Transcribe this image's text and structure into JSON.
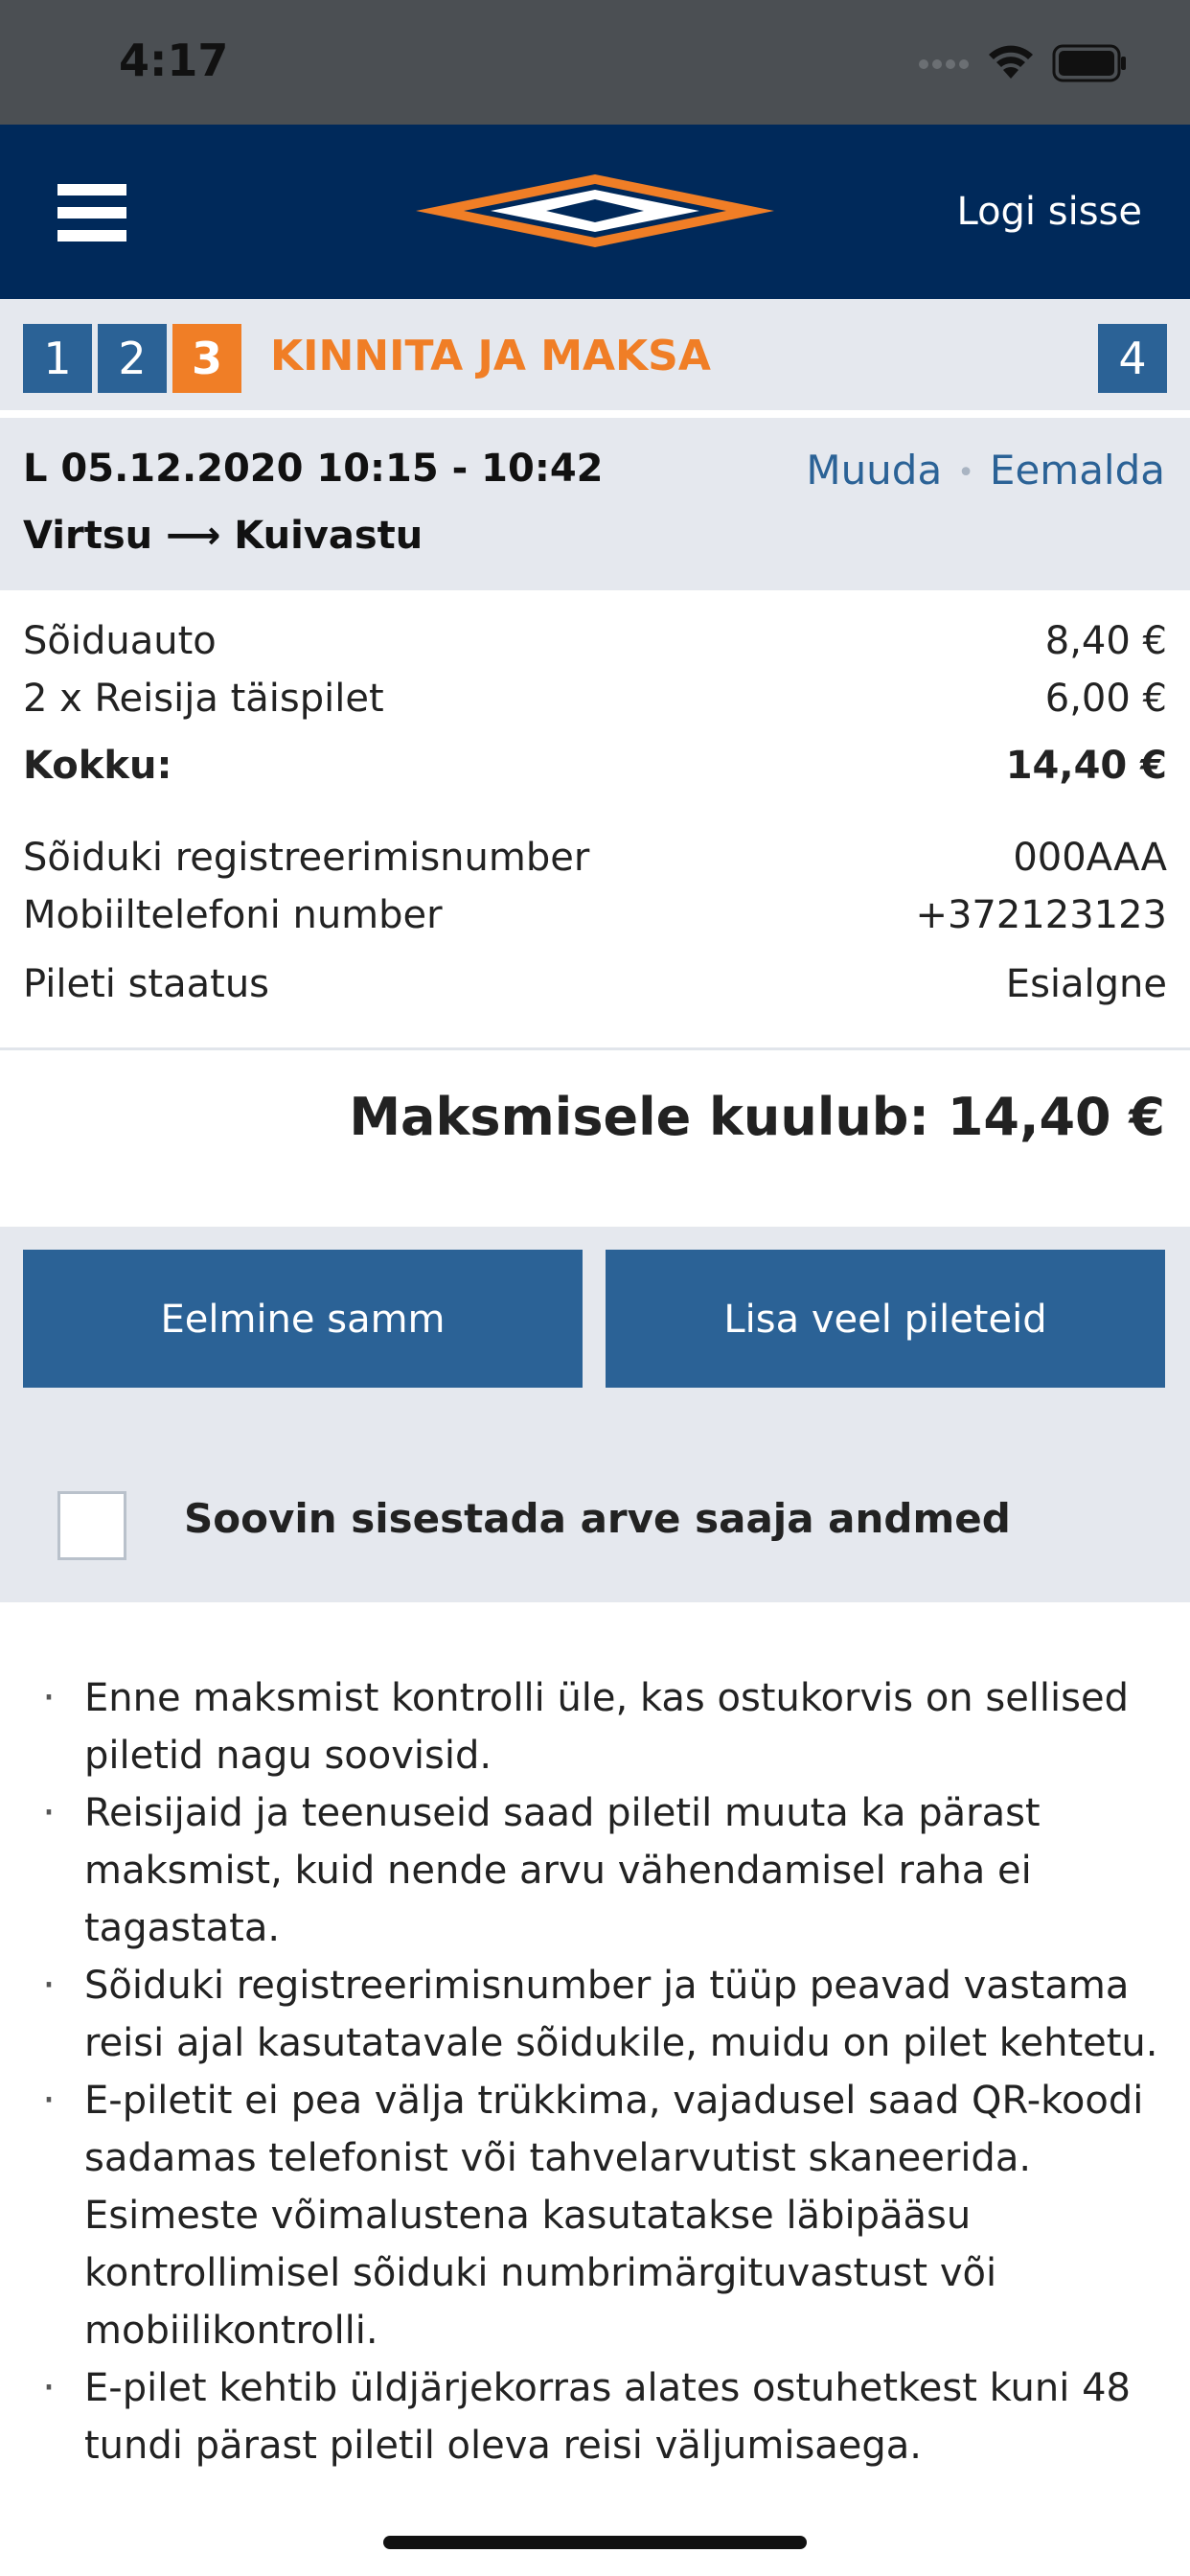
{
  "status_bar": {
    "time": "4:17"
  },
  "header": {
    "login_label": "Logi sisse",
    "colors": {
      "bg": "#00295a",
      "logo_orange": "#f07e26",
      "logo_white": "#ffffff"
    }
  },
  "steps": {
    "items": [
      {
        "label": "1",
        "active": false
      },
      {
        "label": "2",
        "active": false
      },
      {
        "label": "3",
        "active": true
      },
      {
        "label": "4",
        "active": false
      }
    ],
    "current_title": "KINNITA JA MAKSA",
    "colors": {
      "step": "#2b6296",
      "active": "#f07e26"
    }
  },
  "trip": {
    "datetime": "L 05.12.2020 10:15 - 10:42",
    "route": "Virtsu ⟶ Kuivastu",
    "edit_label": "Muuda",
    "remove_label": "Eemalda"
  },
  "details": {
    "items": [
      {
        "label": "Sõiduauto",
        "value": "8,40 €"
      },
      {
        "label": "2 x Reisija täispilet",
        "value": "6,00 €"
      },
      {
        "label": "Kokku:",
        "value": "14,40 €",
        "bold": true
      },
      {
        "label": "Sõiduki registreerimisnumber",
        "value": "000AAA"
      },
      {
        "label": "Mobiiltelefoni number",
        "value": "+372123123"
      },
      {
        "label": "Pileti staatus",
        "value": "Esialgne"
      }
    ]
  },
  "payable": {
    "text": "Maksmisele kuulub: 14,40 €"
  },
  "buttons": {
    "previous_label": "Eelmine samm",
    "add_more_label": "Lisa veel pileteid"
  },
  "invoice_checkbox": {
    "label": "Soovin sisestada arve saaja andmed",
    "checked": false
  },
  "info": {
    "items": [
      "Enne maksmist kontrolli üle, kas ostukorvis on sellised piletid nagu soovisid.",
      "Reisijaid ja teenuseid saad piletil muuta ka pärast maksmist, kuid nende arvu vähendamisel raha ei tagastata.",
      "Sõiduki registreerimisnumber ja tüüp peavad vastama reisi ajal kasutatavale sõidukile, muidu on pilet kehtetu.",
      "E-piletit ei pea välja trükkima, vajadusel saad QR-koodi sadamas telefonist või tahvelarvutist skaneerida. Esimeste võimalustena kasutatakse läbipääsu kontrollimisel sõiduki numbrimärgituvastust või mobiilikontrolli.",
      "E-pilet kehtib üldjärjekorras alates ostuhetkest kuni 48 tundi pärast piletil oleva reisi väljumisaega."
    ]
  }
}
